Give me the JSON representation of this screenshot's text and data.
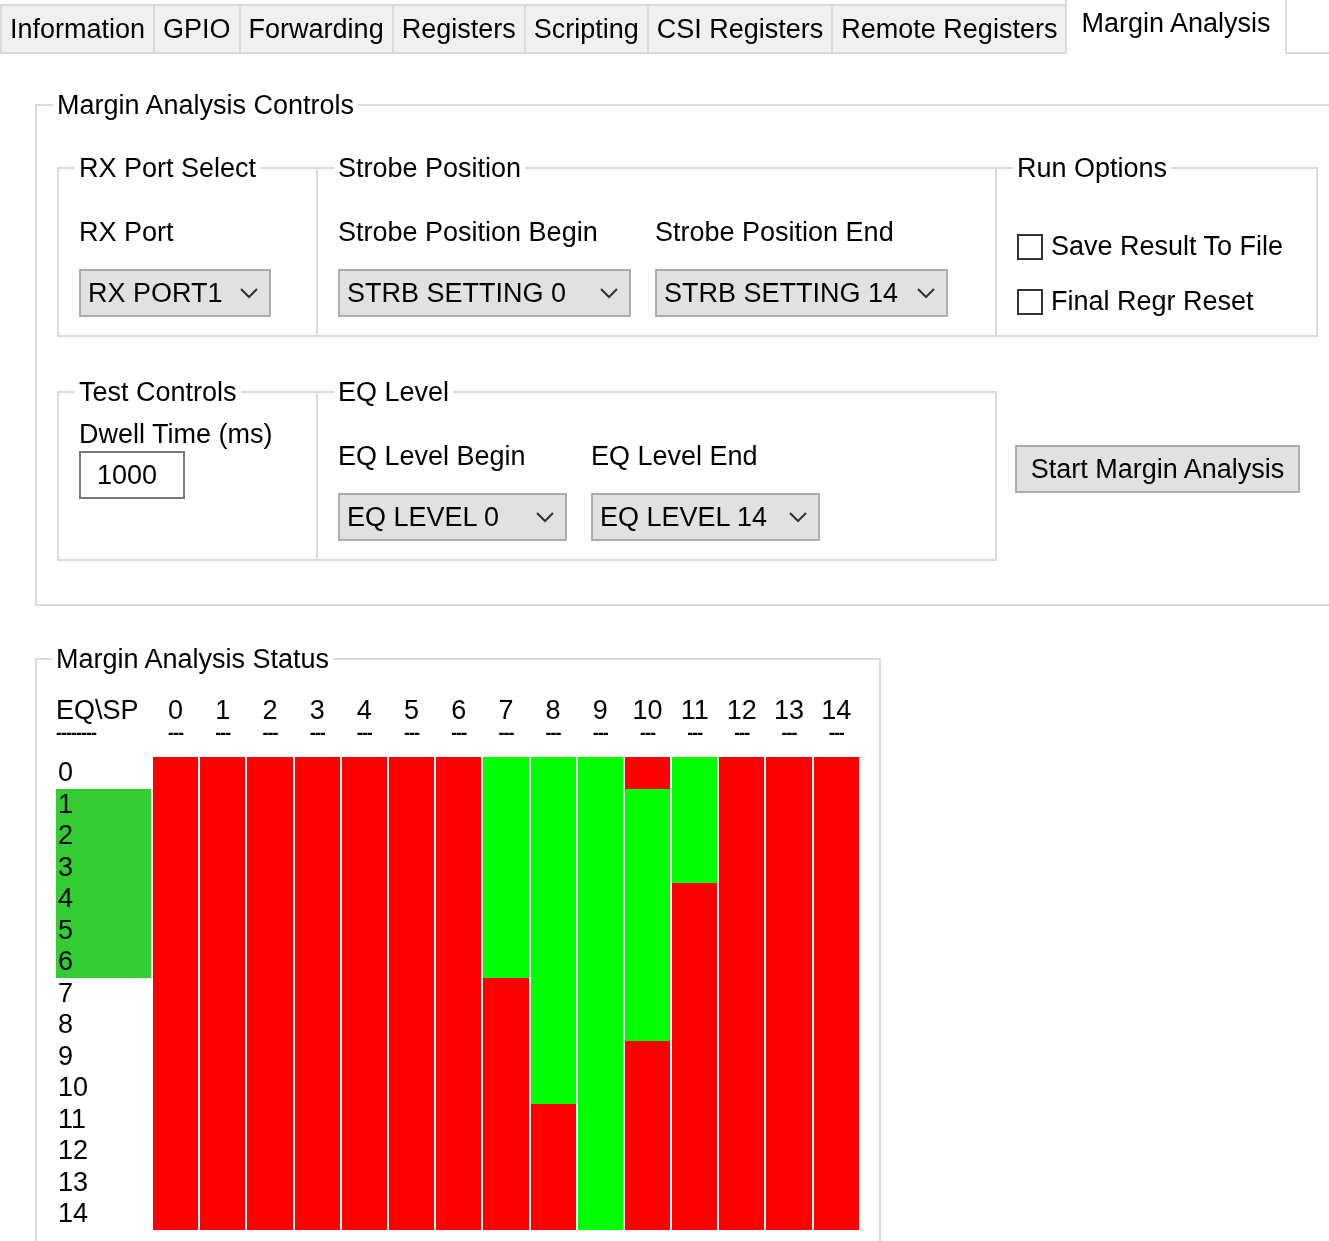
{
  "tabs": [
    {
      "label": "Information",
      "selected": false
    },
    {
      "label": "GPIO",
      "selected": false
    },
    {
      "label": "Forwarding",
      "selected": false
    },
    {
      "label": "Registers",
      "selected": false
    },
    {
      "label": "Scripting",
      "selected": false
    },
    {
      "label": "CSI Registers",
      "selected": false
    },
    {
      "label": "Remote Registers",
      "selected": false
    },
    {
      "label": "Margin Analysis",
      "selected": true
    }
  ],
  "controls": {
    "title": "Margin Analysis Controls",
    "rx_port_select": {
      "title": "RX Port Select",
      "label": "RX Port",
      "value": "RX PORT1"
    },
    "strobe_position": {
      "title": "Strobe Position",
      "begin": {
        "label": "Strobe Position Begin",
        "value": "STRB SETTING 0"
      },
      "end": {
        "label": "Strobe Position End",
        "value": "STRB SETTING 14"
      }
    },
    "run_options": {
      "title": "Run Options",
      "options": [
        {
          "label": "Save Result To File",
          "checked": false
        },
        {
          "label": "Final Regr Reset",
          "checked": false
        }
      ]
    },
    "test_controls": {
      "title": "Test Controls",
      "label": "Dwell Time (ms)",
      "value": "1000"
    },
    "eq_level": {
      "title": "EQ Level",
      "begin": {
        "label": "EQ Level Begin",
        "value": "EQ LEVEL 0"
      },
      "end": {
        "label": "EQ Level End",
        "value": "EQ LEVEL 14"
      }
    },
    "start_button": "Start Margin Analysis"
  },
  "status": {
    "title": "Margin Analysis Status",
    "corner_label": "EQ\\SP",
    "corner_rule": "--------",
    "columns": [
      {
        "label": "0",
        "rule": "---"
      },
      {
        "label": "1",
        "rule": "---"
      },
      {
        "label": "2",
        "rule": "---"
      },
      {
        "label": "3",
        "rule": "---"
      },
      {
        "label": "4",
        "rule": "---"
      },
      {
        "label": "5",
        "rule": "---"
      },
      {
        "label": "6",
        "rule": "---"
      },
      {
        "label": "7",
        "rule": "---"
      },
      {
        "label": "8",
        "rule": "---"
      },
      {
        "label": "9",
        "rule": "---"
      },
      {
        "label": "10",
        "rule": "---"
      },
      {
        "label": "11",
        "rule": "---"
      },
      {
        "label": "12",
        "rule": "---"
      },
      {
        "label": "13",
        "rule": "---"
      },
      {
        "label": "14",
        "rule": "---"
      }
    ],
    "rows": [
      {
        "label": "0",
        "highlighted": false,
        "passed": [
          false,
          false,
          false,
          false,
          false,
          false,
          false,
          true,
          true,
          true,
          false,
          true,
          false,
          false,
          false
        ]
      },
      {
        "label": "1",
        "highlighted": true,
        "passed": [
          false,
          false,
          false,
          false,
          false,
          false,
          false,
          true,
          true,
          true,
          true,
          true,
          false,
          false,
          false
        ]
      },
      {
        "label": "2",
        "highlighted": true,
        "passed": [
          false,
          false,
          false,
          false,
          false,
          false,
          false,
          true,
          true,
          true,
          true,
          true,
          false,
          false,
          false
        ]
      },
      {
        "label": "3",
        "highlighted": true,
        "passed": [
          false,
          false,
          false,
          false,
          false,
          false,
          false,
          true,
          true,
          true,
          true,
          true,
          false,
          false,
          false
        ]
      },
      {
        "label": "4",
        "highlighted": true,
        "passed": [
          false,
          false,
          false,
          false,
          false,
          false,
          false,
          true,
          true,
          true,
          true,
          false,
          false,
          false,
          false
        ]
      },
      {
        "label": "5",
        "highlighted": true,
        "passed": [
          false,
          false,
          false,
          false,
          false,
          false,
          false,
          true,
          true,
          true,
          true,
          false,
          false,
          false,
          false
        ]
      },
      {
        "label": "6",
        "highlighted": true,
        "passed": [
          false,
          false,
          false,
          false,
          false,
          false,
          false,
          true,
          true,
          true,
          true,
          false,
          false,
          false,
          false
        ]
      },
      {
        "label": "7",
        "highlighted": false,
        "passed": [
          false,
          false,
          false,
          false,
          false,
          false,
          false,
          false,
          true,
          true,
          true,
          false,
          false,
          false,
          false
        ]
      },
      {
        "label": "8",
        "highlighted": false,
        "passed": [
          false,
          false,
          false,
          false,
          false,
          false,
          false,
          false,
          true,
          true,
          true,
          false,
          false,
          false,
          false
        ]
      },
      {
        "label": "9",
        "highlighted": false,
        "passed": [
          false,
          false,
          false,
          false,
          false,
          false,
          false,
          false,
          true,
          true,
          false,
          false,
          false,
          false,
          false
        ]
      },
      {
        "label": "10",
        "highlighted": false,
        "passed": [
          false,
          false,
          false,
          false,
          false,
          false,
          false,
          false,
          true,
          true,
          false,
          false,
          false,
          false,
          false
        ]
      },
      {
        "label": "11",
        "highlighted": false,
        "passed": [
          false,
          false,
          false,
          false,
          false,
          false,
          false,
          false,
          false,
          true,
          false,
          false,
          false,
          false,
          false
        ]
      },
      {
        "label": "12",
        "highlighted": false,
        "passed": [
          false,
          false,
          false,
          false,
          false,
          false,
          false,
          false,
          false,
          true,
          false,
          false,
          false,
          false,
          false
        ]
      },
      {
        "label": "13",
        "highlighted": false,
        "passed": [
          false,
          false,
          false,
          false,
          false,
          false,
          false,
          false,
          false,
          true,
          false,
          false,
          false,
          false,
          false
        ]
      },
      {
        "label": "14",
        "highlighted": false,
        "passed": [
          false,
          false,
          false,
          false,
          false,
          false,
          false,
          false,
          false,
          true,
          false,
          false,
          false,
          false,
          false
        ]
      }
    ]
  }
}
